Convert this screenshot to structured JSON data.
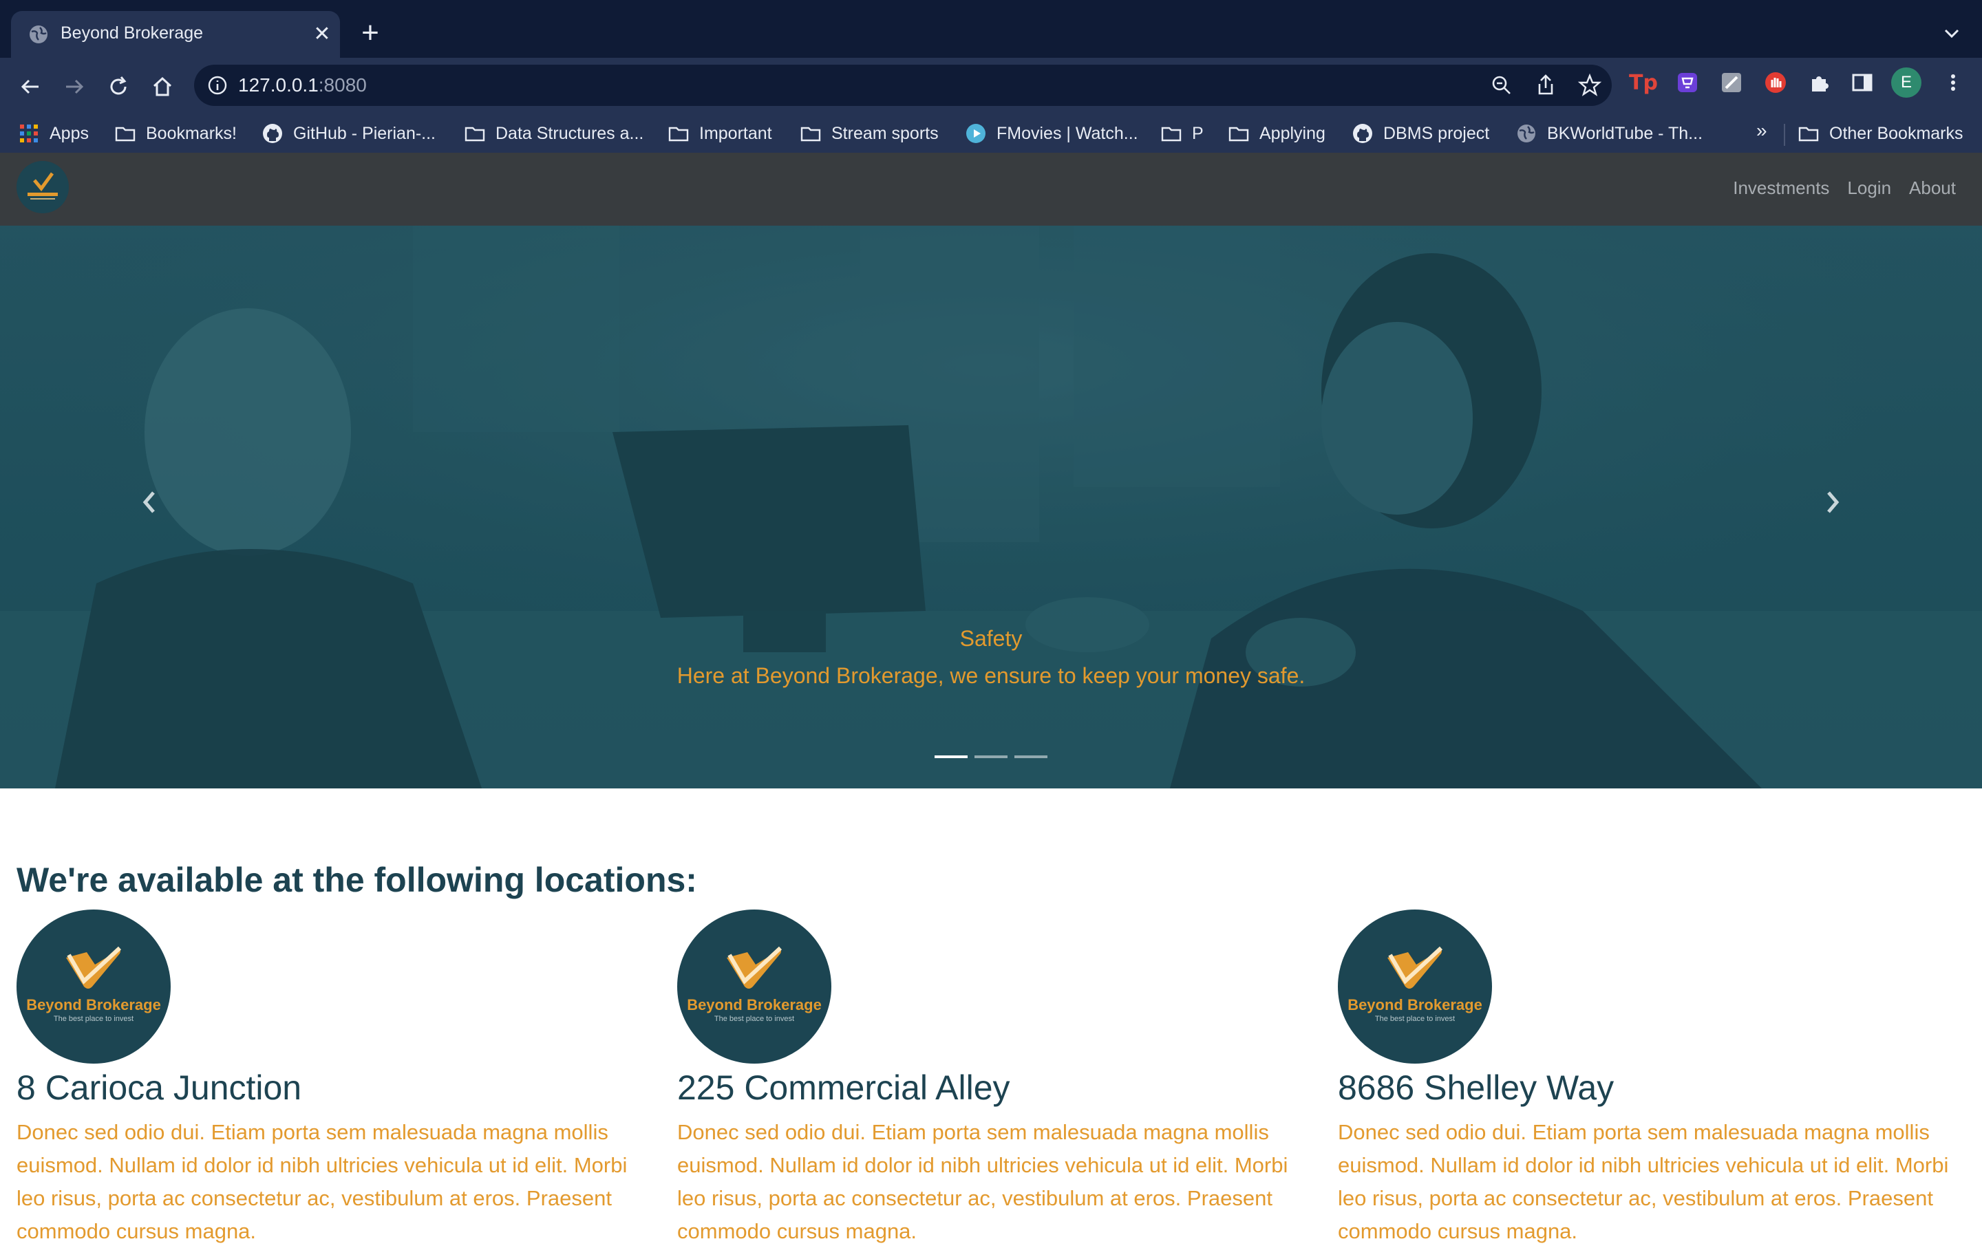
{
  "browser": {
    "tab_title": "Beyond Brokerage",
    "url_host": "127.0.0.1",
    "url_port": ":8080",
    "bookmarks": [
      {
        "label": "Apps",
        "icon": "apps-grid-icon"
      },
      {
        "label": "Bookmarks!",
        "icon": "folder-icon"
      },
      {
        "label": "GitHub - Pierian-...",
        "icon": "github-icon"
      },
      {
        "label": "Data Structures a...",
        "icon": "folder-icon"
      },
      {
        "label": "Important",
        "icon": "folder-icon"
      },
      {
        "label": "Stream sports",
        "icon": "folder-icon"
      },
      {
        "label": "FMovies | Watch...",
        "icon": "play-icon"
      },
      {
        "label": "P",
        "icon": "folder-icon"
      },
      {
        "label": "Applying",
        "icon": "folder-icon"
      },
      {
        "label": "DBMS project",
        "icon": "github-icon"
      },
      {
        "label": "BKWorldTube - Th...",
        "icon": "globe-icon"
      }
    ],
    "more_bookmarks": "»",
    "other_bookmarks": "Other Bookmarks",
    "profile_initial": "E"
  },
  "site": {
    "nav_links": [
      "Investments",
      "Login",
      "About"
    ],
    "hero": {
      "title": "Safety",
      "text": "Here at Beyond Brokerage, we ensure to keep your money safe.",
      "active_slide": 1,
      "slide_count": 3
    },
    "logo": {
      "name": "Beyond Brokerage",
      "tagline": "The best place to invest"
    },
    "section_title": "We're available at the following locations:",
    "locations": [
      {
        "name": "8 Carioca Junction",
        "description": "Donec sed odio dui. Etiam porta sem malesuada magna mollis euismod. Nullam id dolor id nibh ultricies vehicula ut id elit. Morbi leo risus, porta ac consectetur ac, vestibulum at eros. Praesent commodo cursus magna."
      },
      {
        "name": "225 Commercial Alley",
        "description": "Donec sed odio dui. Etiam porta sem malesuada magna mollis euismod. Nullam id dolor id nibh ultricies vehicula ut id elit. Morbi leo risus, porta ac consectetur ac, vestibulum at eros. Praesent commodo cursus magna."
      },
      {
        "name": "8686 Shelley Way",
        "description": "Donec sed odio dui. Etiam porta sem malesuada magna mollis euismod. Nullam id dolor id nibh ultricies vehicula ut id elit. Morbi leo risus, porta ac consectetur ac, vestibulum at eros. Praesent commodo cursus magna."
      }
    ]
  },
  "colors": {
    "brand_teal": "#1d4351",
    "accent_orange": "#e39a2e",
    "navbar": "#383c3f",
    "chrome_dark": "#0f1b36",
    "chrome": "#253353"
  }
}
